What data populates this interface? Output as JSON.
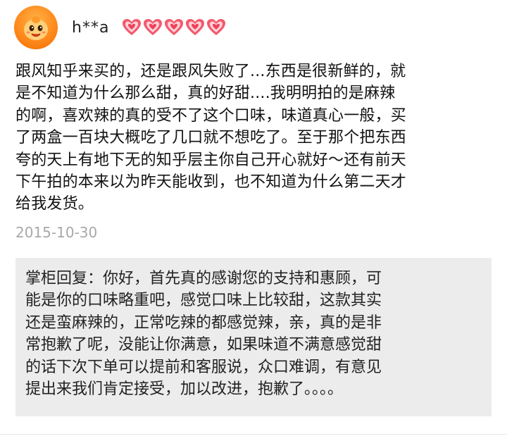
{
  "review": {
    "username": "h**a",
    "level_icon": "red-heart-badge",
    "level_count": 5,
    "comment": "跟风知乎来买的，还是跟风失败了...东西是很新鲜的，就\n是不知道为什么那么甜，真的好甜....我明明拍的是麻辣\n的啊，喜欢辣的真的受不了这个口味，味道真心一般，买\n了两盒一百块大概吃了几口就不想吃了。至于那个把东西\n夸的天上有地下无的知乎层主你自己开心就好～还有前天\n下午拍的本来以为昨天能收到，也不知道为什么第二天才\n给我发货。",
    "date": "2015-10-30",
    "reply": "掌柜回复：你好，首先真的感谢您的支持和惠顾，可\n能是你的口味略重吧，感觉口味上比较甜，这款其实\n还是蛮麻辣的，正常吃辣的都感觉辣，亲，真的是非\n常抱歉了呢，没能让你满意，如果味道不满意感觉甜\n的话下次下单可以提前和客服说，众口难调，有意见\n提出来我们肯定接受，加以改进，抱歉了。。。。",
    "colors": {
      "heart": "#f0405a",
      "reply_bg": "#ececec",
      "date": "#a8a8a8"
    }
  }
}
